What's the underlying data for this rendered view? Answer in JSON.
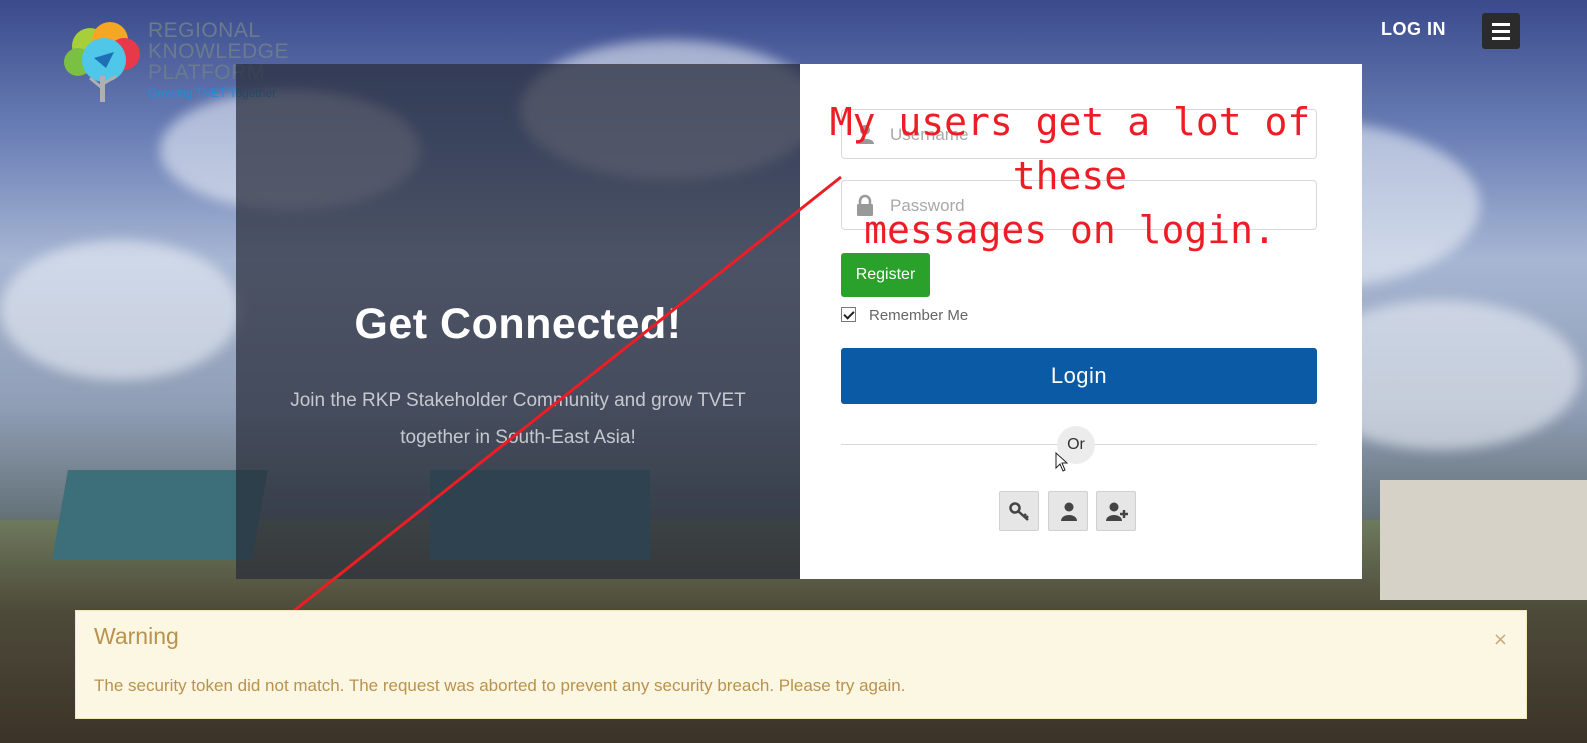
{
  "header": {
    "logo_lines": [
      "REGIONAL",
      "KNOWLEDGE",
      "PLATFORM"
    ],
    "logo_tagline": "Growing TVET Together",
    "login_link": "LOG IN",
    "menu_icon": "hamburger-icon"
  },
  "hero": {
    "title": "Get Connected!",
    "subtitle": "Join the RKP Stakeholder Community and grow TVET together in South-East Asia!"
  },
  "login_form": {
    "username": {
      "value": "",
      "placeholder": "Username",
      "icon": "user-icon"
    },
    "password": {
      "value": "",
      "placeholder": "Password",
      "icon": "lock-icon"
    },
    "register_label": "Register",
    "remember_me_label": "Remember Me",
    "remember_me_checked": true,
    "login_label": "Login",
    "or_label": "Or",
    "icon_buttons": [
      "key-icon",
      "user-icon",
      "user-plus-icon"
    ]
  },
  "annotation": {
    "line1": "My users get a lot of these",
    "line2": "messages on login."
  },
  "alert": {
    "title": "Warning",
    "message": "The security token did not match. The request was aborted to prevent any security breach. Please try again.",
    "close": "×"
  },
  "colors": {
    "primary": "#0a5aa6",
    "success": "#2aa12b",
    "annotation": "#ee1c24",
    "warning_bg": "#fcf7e3",
    "warning_text": "#b9924d"
  }
}
